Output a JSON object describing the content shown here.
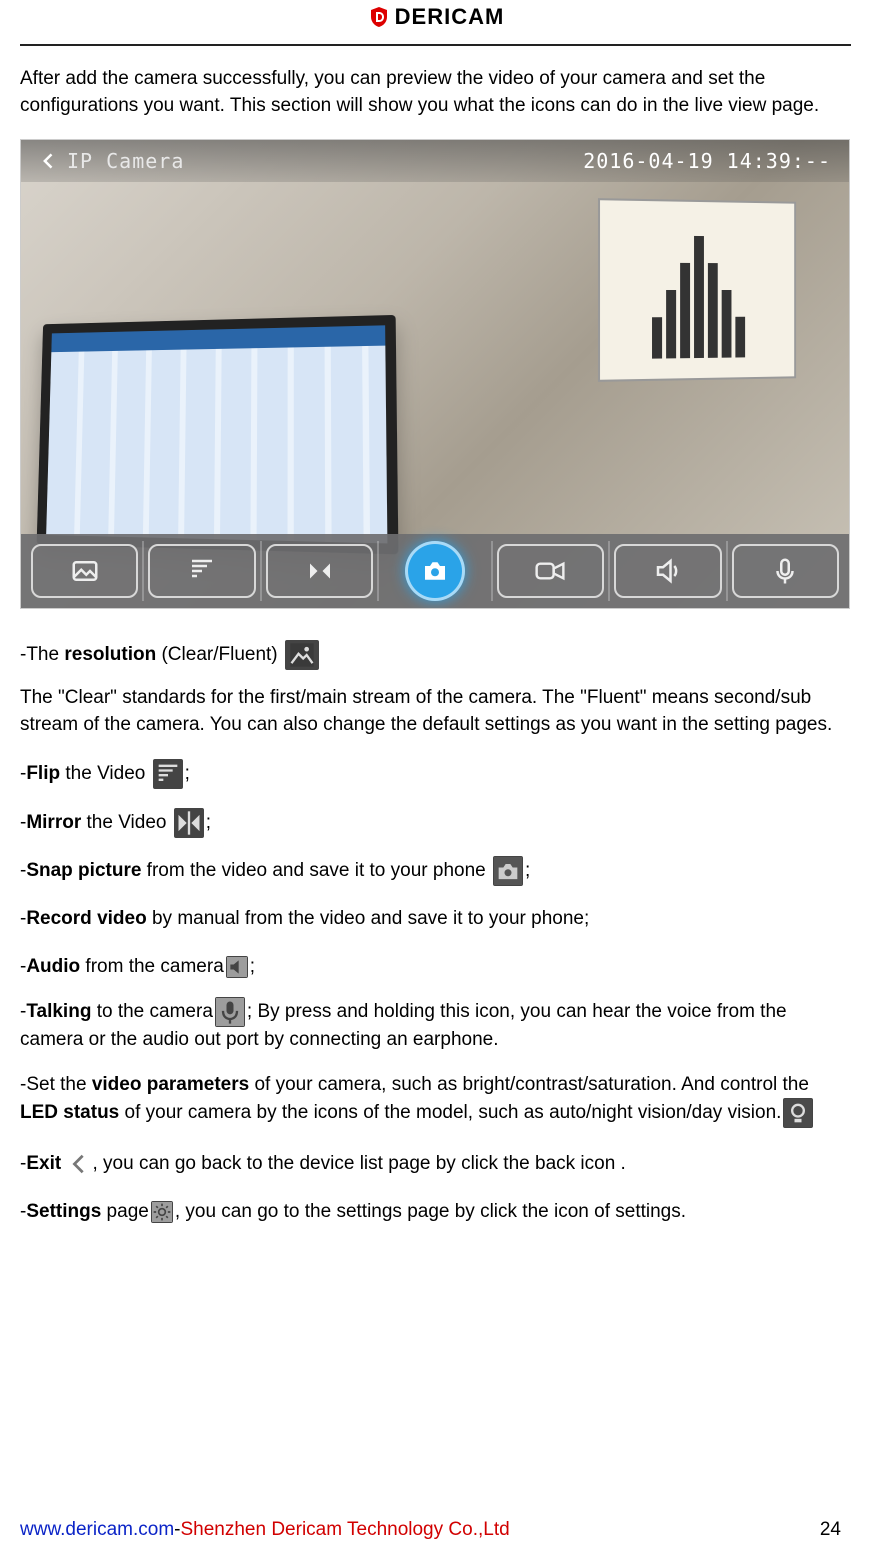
{
  "brand": "DERICAM",
  "intro": "After add the camera successfully, you can preview the video of your camera and set the configurations you want. This section will show you what the icons can do in the live view page.",
  "screenshot": {
    "title": "IP Camera",
    "timestamp": "2016-04-19 14:39:--"
  },
  "items": {
    "resolution": {
      "pre": "-The ",
      "bold": "resolution",
      "post": " (Clear/Fluent) "
    },
    "resolution_desc": "The \"Clear\" standards for the first/main stream of the camera. The \"Fluent\" means second/sub stream of the camera. You can also change the default settings as you want in the setting pages.",
    "flip": {
      "pre": "-",
      "bold": "Flip",
      "post": " the Video ",
      "tail": ";"
    },
    "mirror": {
      "pre": "-",
      "bold": "Mirror",
      "post": " the Video ",
      "tail": ";"
    },
    "snap": {
      "pre": "-",
      "bold": "Snap picture",
      "post": " from the video and save it to your phone ",
      "tail": ";"
    },
    "record": {
      "pre": "-",
      "bold": "Record video",
      "post": " by manual from the video and save it to your phone;",
      "tail": ""
    },
    "audio": {
      "pre": "-",
      "bold": "Audio",
      "post": " from the camera",
      "tail": ";"
    },
    "talking": {
      "pre": "-",
      "bold": "Talking",
      "post": " to the camera",
      "tail": "; By press and holding this icon, you can hear the voice from the camera or the audio out port by connecting an earphone."
    },
    "params": {
      "p1": "-Set the ",
      "b1": "video parameters",
      "p2": " of your camera, such as bright/contrast/saturation. And control the ",
      "b2": "LED status",
      "p3": " of your camera by the icons of the model, such as auto/night vision/day vision."
    },
    "exit": {
      "pre": "-",
      "bold": "Exit",
      "post": " ",
      "tail": ", you can go back to the device list page by click the back icon ."
    },
    "settings": {
      "pre": "-",
      "bold": "Settings",
      "post": " page",
      "tail": ", you can go to the settings page by click the icon of settings."
    }
  },
  "footer": {
    "url": "www.dericam.com",
    "dash": "-",
    "company": "Shenzhen Dericam Technology Co.,Ltd",
    "page": "24"
  }
}
